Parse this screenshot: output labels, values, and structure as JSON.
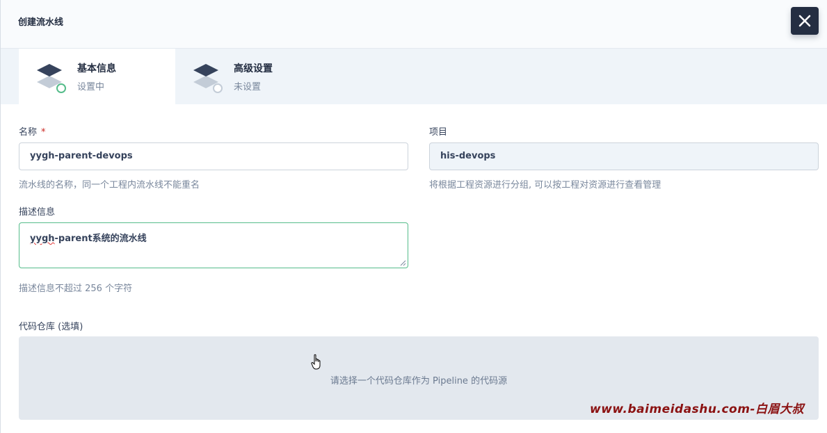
{
  "modal": {
    "title": "创建流水线"
  },
  "steps": [
    {
      "title": "基本信息",
      "status": "设置中",
      "state": "active"
    },
    {
      "title": "高级设置",
      "status": "未设置",
      "state": "pending"
    }
  ],
  "form": {
    "name": {
      "label": "名称",
      "required_mark": "*",
      "value": "yygh-parent-devops",
      "hint": "流水线的名称，同一个工程内流水线不能重名"
    },
    "project": {
      "label": "项目",
      "value": "his-devops",
      "hint": "将根据工程资源进行分组, 可以按工程对资源进行查看管理"
    },
    "description": {
      "label": "描述信息",
      "value_spell": "yygh",
      "value_rest": "-parent系统的流水线",
      "hint": "描述信息不超过 256 个字符"
    },
    "repo": {
      "label": "代码仓库 (选填)",
      "placeholder": "请选择一个代码仓库作为 Pipeline 的代码源"
    }
  },
  "watermark": "www.baimeidashu.com-白眉大叔",
  "colors": {
    "accent_green": "#55bc8a",
    "dark": "#242e42",
    "required": "#ca2621",
    "watermark": "#8b1212"
  },
  "icons": {
    "close": "close-icon",
    "step": "layers-icon",
    "cursor": "hand-pointer-icon"
  }
}
